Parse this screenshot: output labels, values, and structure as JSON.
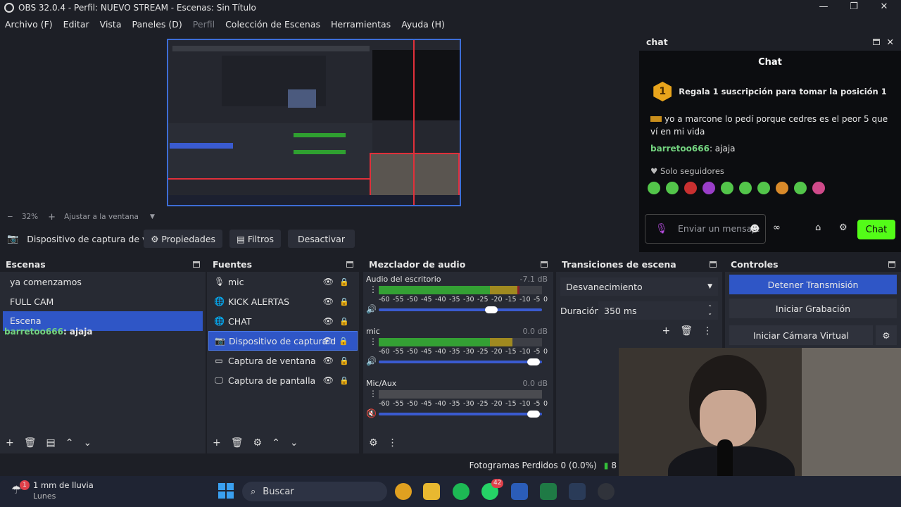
{
  "window": {
    "title": "OBS 32.0.4 - Perfil: NUEVO STREAM - Escenas: Sin Título"
  },
  "menu": [
    {
      "label": "Archivo (F)",
      "disabled": false
    },
    {
      "label": "Editar",
      "disabled": false
    },
    {
      "label": "Vista",
      "disabled": false
    },
    {
      "label": "Paneles (D)",
      "disabled": false
    },
    {
      "label": "Perfil",
      "disabled": true
    },
    {
      "label": "Colección de Escenas",
      "disabled": false
    },
    {
      "label": "Herramientas",
      "disabled": false
    },
    {
      "label": "Ayuda (H)",
      "disabled": false
    }
  ],
  "zoom": {
    "minus": "−",
    "value": "32%",
    "plus": "+",
    "fit": "Ajustar a la ventana"
  },
  "source_toolbar": {
    "source_name": "Dispositivo de captura de v",
    "properties": "Propiedades",
    "filters": "Filtros",
    "deactivate": "Desactivar"
  },
  "scenes": {
    "title": "Escenas",
    "items": [
      "ya comenzamos",
      "FULL CAM",
      "Escena"
    ],
    "selected_index": 2,
    "overlay_user": "barretoo666",
    "overlay_text": ": ajaja"
  },
  "sources": {
    "title": "Fuentes",
    "items": [
      {
        "label": "mic",
        "icon": "mic-icon"
      },
      {
        "label": "KICK ALERTAS",
        "icon": "browser-icon"
      },
      {
        "label": "CHAT",
        "icon": "browser-icon"
      },
      {
        "label": "Dispositivo de captura d",
        "icon": "camera-icon"
      },
      {
        "label": "Captura de ventana",
        "icon": "window-icon"
      },
      {
        "label": "Captura de pantalla",
        "icon": "monitor-icon"
      }
    ],
    "selected_index": 3
  },
  "mixer": {
    "title": "Mezclador de audio",
    "scale": [
      "-60",
      "-55",
      "-50",
      "-45",
      "-40",
      "-35",
      "-30",
      "-25",
      "-20",
      "-15",
      "-10",
      "-5",
      "0"
    ],
    "channels": [
      {
        "name": "Audio del escritorio",
        "db": "-7.1 dB",
        "level": 0.86,
        "volume": 0.72,
        "muted": false
      },
      {
        "name": "mic",
        "db": "0.0 dB",
        "level": 0.82,
        "volume": 0.98,
        "muted": false
      },
      {
        "name": "Mic/Aux",
        "db": "0.0 dB",
        "level": 0.0,
        "volume": 0.98,
        "muted": true
      }
    ]
  },
  "transitions": {
    "title": "Transiciones de escena",
    "selected": "Desvanecimiento",
    "duration_label": "Duración",
    "duration": "350 ms"
  },
  "controls": {
    "title": "Controles",
    "stop_stream": "Detener Transmisión",
    "start_record": "Iniciar Grabación",
    "virtual_cam": "Iniciar Cámara Virtual"
  },
  "chat": {
    "dock_title": "chat",
    "title": "Chat",
    "banner_rank": "1",
    "banner": "Regala 1 suscripción para tomar la posición 1",
    "messages": [
      {
        "user": "",
        "text": "yo a marcone lo pedí porque cedres es el peor 5 que ví en mi vida"
      },
      {
        "user": "barretoo666",
        "text": ": ajaja"
      }
    ],
    "followers_only": "Solo seguidores",
    "input_placeholder": "Enviar un mensaje",
    "send": "Chat"
  },
  "status": {
    "dropped_frames": "Fotogramas Perdidos 0 (0.0%)",
    "bitrate": "8"
  },
  "taskbar": {
    "weather": "1 mm de lluvia",
    "day": "Lunes",
    "search": "Buscar",
    "badge_weather": "1",
    "badge_whatsapp": "42"
  },
  "colors": {
    "accent": "#2f56c6",
    "kick_green": "#53fc18",
    "username": "#73d37f"
  }
}
